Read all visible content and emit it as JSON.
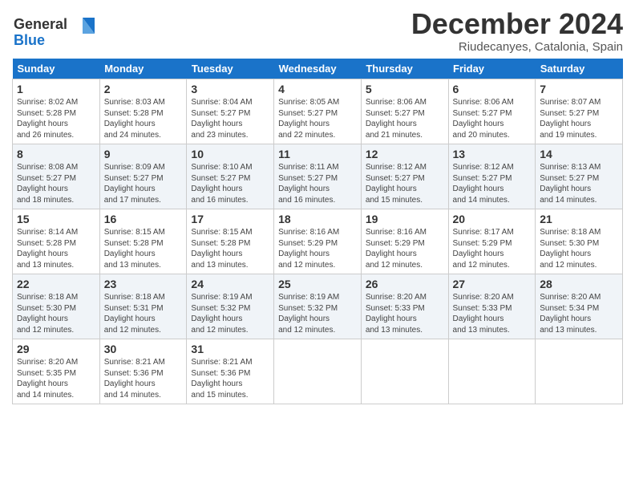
{
  "header": {
    "logo_line1": "General",
    "logo_line2": "Blue",
    "month_title": "December 2024",
    "location": "Riudecanyes, Catalonia, Spain"
  },
  "weekdays": [
    "Sunday",
    "Monday",
    "Tuesday",
    "Wednesday",
    "Thursday",
    "Friday",
    "Saturday"
  ],
  "weeks": [
    [
      {
        "day": "1",
        "sunrise": "8:02 AM",
        "sunset": "5:28 PM",
        "daylight": "9 hours and 26 minutes."
      },
      {
        "day": "2",
        "sunrise": "8:03 AM",
        "sunset": "5:28 PM",
        "daylight": "9 hours and 24 minutes."
      },
      {
        "day": "3",
        "sunrise": "8:04 AM",
        "sunset": "5:27 PM",
        "daylight": "9 hours and 23 minutes."
      },
      {
        "day": "4",
        "sunrise": "8:05 AM",
        "sunset": "5:27 PM",
        "daylight": "9 hours and 22 minutes."
      },
      {
        "day": "5",
        "sunrise": "8:06 AM",
        "sunset": "5:27 PM",
        "daylight": "9 hours and 21 minutes."
      },
      {
        "day": "6",
        "sunrise": "8:06 AM",
        "sunset": "5:27 PM",
        "daylight": "9 hours and 20 minutes."
      },
      {
        "day": "7",
        "sunrise": "8:07 AM",
        "sunset": "5:27 PM",
        "daylight": "9 hours and 19 minutes."
      }
    ],
    [
      {
        "day": "8",
        "sunrise": "8:08 AM",
        "sunset": "5:27 PM",
        "daylight": "9 hours and 18 minutes."
      },
      {
        "day": "9",
        "sunrise": "8:09 AM",
        "sunset": "5:27 PM",
        "daylight": "9 hours and 17 minutes."
      },
      {
        "day": "10",
        "sunrise": "8:10 AM",
        "sunset": "5:27 PM",
        "daylight": "9 hours and 16 minutes."
      },
      {
        "day": "11",
        "sunrise": "8:11 AM",
        "sunset": "5:27 PM",
        "daylight": "9 hours and 16 minutes."
      },
      {
        "day": "12",
        "sunrise": "8:12 AM",
        "sunset": "5:27 PM",
        "daylight": "9 hours and 15 minutes."
      },
      {
        "day": "13",
        "sunrise": "8:12 AM",
        "sunset": "5:27 PM",
        "daylight": "9 hours and 14 minutes."
      },
      {
        "day": "14",
        "sunrise": "8:13 AM",
        "sunset": "5:27 PM",
        "daylight": "9 hours and 14 minutes."
      }
    ],
    [
      {
        "day": "15",
        "sunrise": "8:14 AM",
        "sunset": "5:28 PM",
        "daylight": "9 hours and 13 minutes."
      },
      {
        "day": "16",
        "sunrise": "8:15 AM",
        "sunset": "5:28 PM",
        "daylight": "9 hours and 13 minutes."
      },
      {
        "day": "17",
        "sunrise": "8:15 AM",
        "sunset": "5:28 PM",
        "daylight": "9 hours and 13 minutes."
      },
      {
        "day": "18",
        "sunrise": "8:16 AM",
        "sunset": "5:29 PM",
        "daylight": "9 hours and 12 minutes."
      },
      {
        "day": "19",
        "sunrise": "8:16 AM",
        "sunset": "5:29 PM",
        "daylight": "9 hours and 12 minutes."
      },
      {
        "day": "20",
        "sunrise": "8:17 AM",
        "sunset": "5:29 PM",
        "daylight": "9 hours and 12 minutes."
      },
      {
        "day": "21",
        "sunrise": "8:18 AM",
        "sunset": "5:30 PM",
        "daylight": "9 hours and 12 minutes."
      }
    ],
    [
      {
        "day": "22",
        "sunrise": "8:18 AM",
        "sunset": "5:30 PM",
        "daylight": "9 hours and 12 minutes."
      },
      {
        "day": "23",
        "sunrise": "8:18 AM",
        "sunset": "5:31 PM",
        "daylight": "9 hours and 12 minutes."
      },
      {
        "day": "24",
        "sunrise": "8:19 AM",
        "sunset": "5:32 PM",
        "daylight": "9 hours and 12 minutes."
      },
      {
        "day": "25",
        "sunrise": "8:19 AM",
        "sunset": "5:32 PM",
        "daylight": "9 hours and 12 minutes."
      },
      {
        "day": "26",
        "sunrise": "8:20 AM",
        "sunset": "5:33 PM",
        "daylight": "9 hours and 13 minutes."
      },
      {
        "day": "27",
        "sunrise": "8:20 AM",
        "sunset": "5:33 PM",
        "daylight": "9 hours and 13 minutes."
      },
      {
        "day": "28",
        "sunrise": "8:20 AM",
        "sunset": "5:34 PM",
        "daylight": "9 hours and 13 minutes."
      }
    ],
    [
      {
        "day": "29",
        "sunrise": "8:20 AM",
        "sunset": "5:35 PM",
        "daylight": "9 hours and 14 minutes."
      },
      {
        "day": "30",
        "sunrise": "8:21 AM",
        "sunset": "5:36 PM",
        "daylight": "9 hours and 14 minutes."
      },
      {
        "day": "31",
        "sunrise": "8:21 AM",
        "sunset": "5:36 PM",
        "daylight": "9 hours and 15 minutes."
      },
      null,
      null,
      null,
      null
    ]
  ],
  "labels": {
    "sunrise": "Sunrise:",
    "sunset": "Sunset:",
    "daylight": "Daylight hours"
  }
}
